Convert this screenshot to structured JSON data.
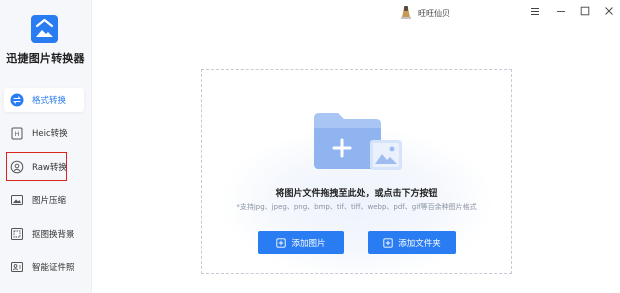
{
  "app": {
    "name": "迅捷图片转换器"
  },
  "sidebar": {
    "items": [
      {
        "label": "格式转换",
        "icon": "format-convert-icon",
        "active": true
      },
      {
        "label": "Heic转换",
        "icon": "heic-icon",
        "active": false
      },
      {
        "label": "Raw转换",
        "icon": "raw-icon",
        "active": false
      },
      {
        "label": "图片压缩",
        "icon": "compress-icon",
        "active": false
      },
      {
        "label": "抠图换背景",
        "icon": "cutout-icon",
        "active": false
      },
      {
        "label": "智能证件照",
        "icon": "id-photo-icon",
        "active": false
      }
    ]
  },
  "titlebar": {
    "username": "旺旺仙贝",
    "buttons": [
      "menu-icon",
      "minimize-icon",
      "maximize-icon",
      "close-icon"
    ]
  },
  "dropzone": {
    "main_text": "将图片文件拖拽至此处，或点击下方按钮",
    "sub_text": "*支持jpg、jpeg、png、bmp、tif、tiff、webp、pdf、gif等百余种图片格式",
    "add_image_label": "添加图片",
    "add_folder_label": "添加文件夹"
  },
  "colors": {
    "accent": "#2a7cf2",
    "highlight": "#d9261c",
    "sidebar_bg": "#f6f7fb"
  }
}
